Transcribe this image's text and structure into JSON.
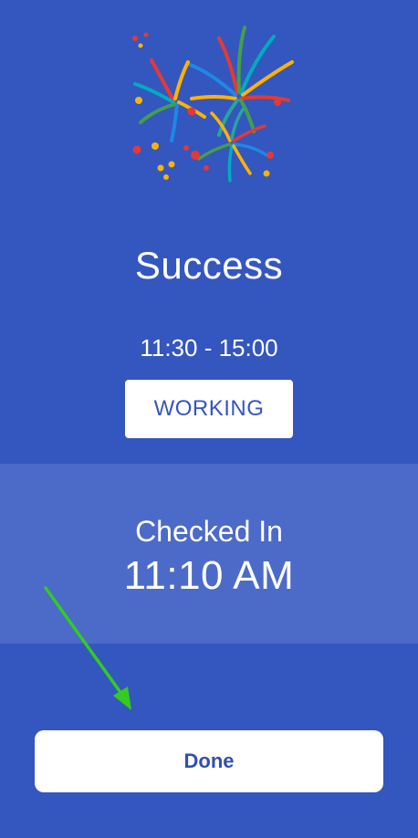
{
  "header": {
    "illustration": "fireworks-icon"
  },
  "result": {
    "title": "Success",
    "shift_time": "11:30 - 15:00",
    "status": "WORKING"
  },
  "checkin": {
    "label": "Checked In",
    "time": "11:10 AM"
  },
  "actions": {
    "done_label": "Done"
  },
  "annotation": {
    "pointer": "green-arrow-icon",
    "color": "#33CC1F"
  },
  "colors": {
    "background": "#3456BF",
    "panel": "#4C6AC8",
    "accent_text": "#2F4FB3"
  }
}
